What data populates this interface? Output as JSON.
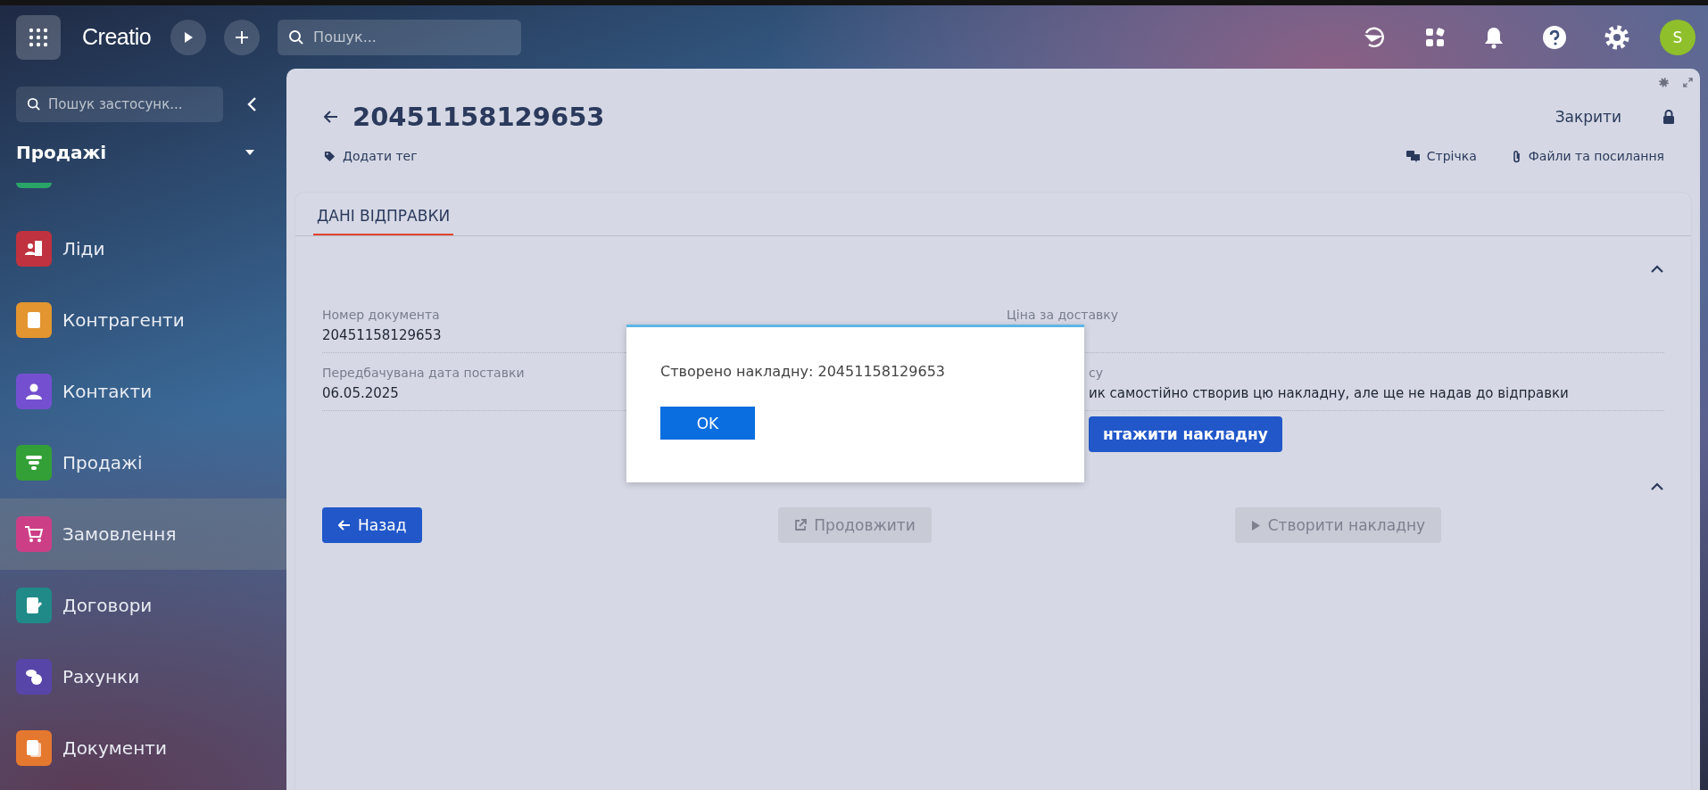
{
  "top_bar": {
    "logo": "Creatio",
    "search": {
      "placeholder": "Пошук..."
    },
    "avatar": "S"
  },
  "sidebar": {
    "search": {
      "placeholder": "Пошук застосунк..."
    },
    "section": "Продажі",
    "items": [
      {
        "label": "Ліди",
        "kind": "leads",
        "color": "#c0323f",
        "selected": false
      },
      {
        "label": "Контрагенти",
        "kind": "building",
        "color": "#e3952f",
        "selected": false
      },
      {
        "label": "Контакти",
        "kind": "person",
        "color": "#7450d0",
        "selected": false
      },
      {
        "label": "Продажі",
        "kind": "funnel",
        "color": "#33a037",
        "selected": false
      },
      {
        "label": "Замовлення",
        "kind": "cart",
        "color": "#cc3f86",
        "selected": true
      },
      {
        "label": "Договори",
        "kind": "contract",
        "color": "#1f8a88",
        "selected": false
      },
      {
        "label": "Рахунки",
        "kind": "coins",
        "color": "#5845a8",
        "selected": false
      },
      {
        "label": "Документи",
        "kind": "pages",
        "color": "#e5782f",
        "selected": false
      }
    ]
  },
  "record": {
    "title": "20451158129653",
    "tag_button": "Додати тег",
    "close_button": "Закрити",
    "feed_button": "Стрічка",
    "files_button": "Файли та посилання"
  },
  "tabs": [
    {
      "label": "ДАНІ ВІДПРАВКИ",
      "selected": true
    }
  ],
  "sections": [
    {
      "expanded": true
    },
    {
      "expanded": true
    }
  ],
  "fields_left": [
    {
      "label": "Номер документа",
      "value": "20451158129653"
    },
    {
      "label": "Передбачувана дата поставки",
      "value": "06.05.2025"
    }
  ],
  "fields_right": [
    {
      "label": "Ціна за доставку"
    }
  ],
  "overlapped_field": {
    "label": "су",
    "value": "ик самостійно створив цю накладну, але ще не надав до відправки"
  },
  "overlapped_button": "нтажити накладну",
  "actions": [
    {
      "label": "Назад",
      "kind": "back",
      "disabled": false
    },
    {
      "label": "Продовжити",
      "kind": "open",
      "disabled": true
    },
    {
      "label": "Створити накладну",
      "kind": "run",
      "disabled": true
    }
  ],
  "dialog": {
    "message": "Створено накладну: 20451158129653",
    "button": "OK"
  }
}
